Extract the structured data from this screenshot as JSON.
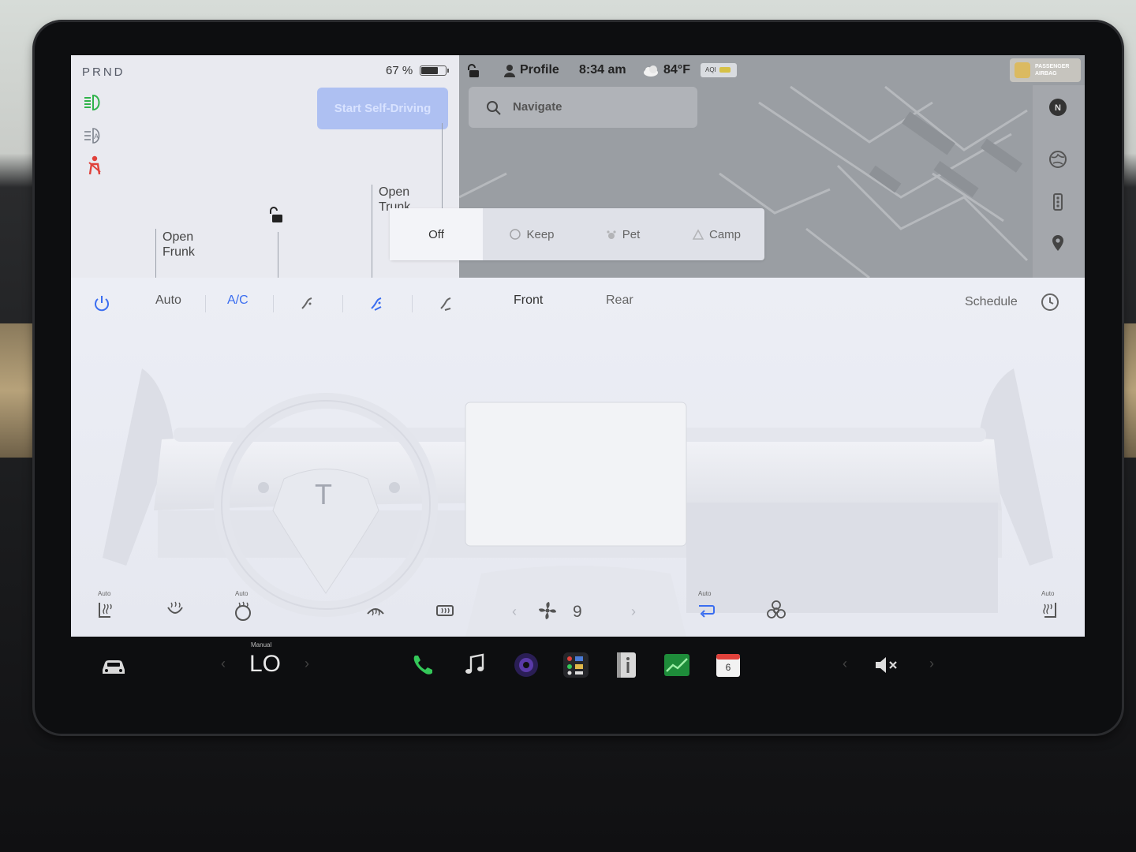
{
  "gear": {
    "label": "PRND"
  },
  "battery": {
    "percent_label": "67 %",
    "level": 0.67
  },
  "autopilot": {
    "button_label": "Start Self-Driving"
  },
  "frunk": {
    "line1": "Open",
    "line2": "Frunk"
  },
  "trunk": {
    "line1": "Open",
    "line2": "Trunk"
  },
  "status_bar": {
    "profile_label": "Profile",
    "time": "8:34 am",
    "temperature": "84°F",
    "aqi_label": "AQI",
    "airbag_line1": "PASSENGER",
    "airbag_line2": "AIRBAG"
  },
  "navigate": {
    "placeholder": "Navigate"
  },
  "climate_modes": {
    "off": "Off",
    "keep": "Keep",
    "pet": "Pet",
    "camp": "Camp",
    "active": "off"
  },
  "climate": {
    "auto_label": "Auto",
    "ac_label": "A/C",
    "front_label": "Front",
    "rear_label": "Rear",
    "schedule_label": "Schedule",
    "fan_speed": "9",
    "seat_auto_left": "Auto",
    "wheel_auto": "Auto",
    "recirc_auto": "Auto",
    "seat_auto_right": "Auto"
  },
  "taskbar": {
    "temp_mode": "Manual",
    "temperature": "LO",
    "calendar_day": "6"
  },
  "colors": {
    "accent_blue": "#3a6df0",
    "selfdrive_button": "#aec0f2",
    "phone_green": "#34c759",
    "warning_red": "#e0413b",
    "headlight_green": "#2fb34a"
  }
}
